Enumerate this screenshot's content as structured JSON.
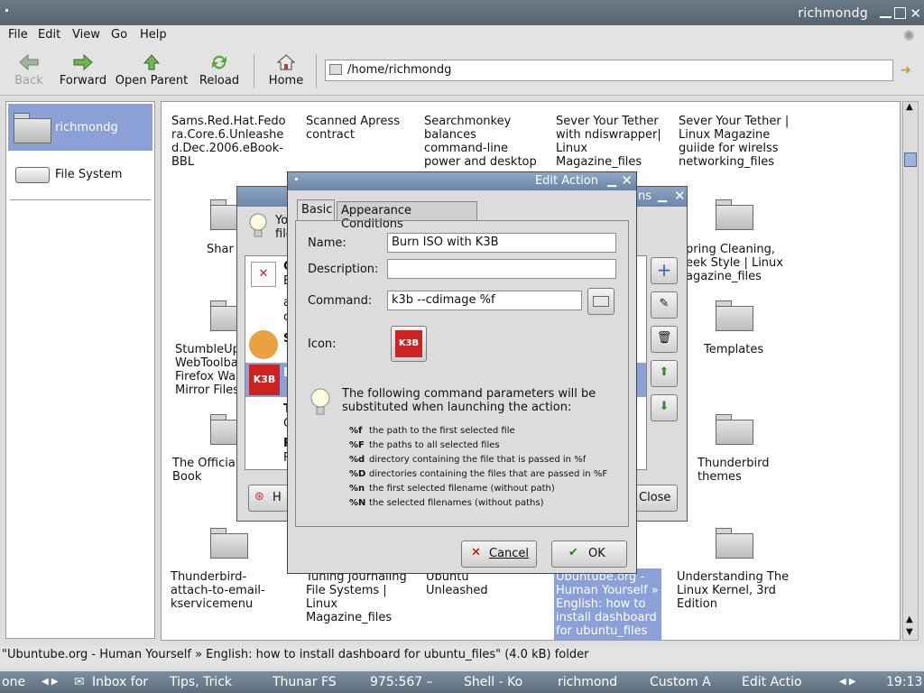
{
  "window": {
    "title": "richmondg"
  },
  "menu": [
    "File",
    "Edit",
    "View",
    "Go",
    "Help"
  ],
  "toolbar": {
    "back": "Back",
    "forward": "Forward",
    "open_parent": "Open Parent",
    "reload": "Reload",
    "home": "Home"
  },
  "location": {
    "path": "/home/richmondg"
  },
  "sidebar": [
    {
      "label": "richmondg",
      "icon": "home-folder-icon"
    },
    {
      "label": "File System",
      "icon": "drive-icon"
    }
  ],
  "files": {
    "row1": [
      "Sams.Red.Hat.Fedora.Core.6.Unleashed.Dec.2006.eBook-BBL",
      "Scanned Apress contract",
      "Searchmonkey balances command-line power and desktop",
      "Sever Your Tether with ndiswrapper| Linux Magazine_files",
      "Sever Your Tether | Linux Magazine guiide for wirelss networking_files"
    ],
    "row2_visible": [
      "Shar",
      "pring Cleaning, eek Style | Linux agazine_files"
    ],
    "row3_visible": [
      "StumbleUp WebToolba Firefox Wal Mirror Files",
      "Templates"
    ],
    "row4_visible": [
      "The Official Book",
      "Thunderbird themes"
    ],
    "row5": [
      "Thunderbird-attach-to-email-kservicemenu",
      "Tuning Journaling File Systems | Linux Magazine_files",
      "Ubuntu Unleashed",
      "Ubuntube.org - Human Yourself » English: how to install dashboard for ubuntu_files",
      "Understanding The Linux Kernel, 3rd Edition"
    ]
  },
  "statusbar": {
    "text": "\"Ubuntube.org - Human Yourself » English: how to install dashboard for ubuntu_files\" (4.0 kB) folder"
  },
  "taskbar": {
    "items": [
      "one",
      "Inbox for",
      "Tips, Trick",
      "Thunar FS",
      "975:567 –",
      "Shell - Ko",
      "richmond",
      "Custom A",
      "Edit Actio"
    ],
    "clock": "19:13"
  },
  "bg_dialog": {
    "title_fragment": "ns",
    "info_fragment": [
      "Yo",
      "file"
    ],
    "close_label": "Close",
    "help_label": "H",
    "list_fragments": [
      "C",
      "E",
      "a",
      "c",
      "S",
      "B",
      "T",
      "C",
      "P",
      "F"
    ]
  },
  "dialog": {
    "title": "Edit Action",
    "tabs": [
      "Basic",
      "Appearance Conditions"
    ],
    "name_label": "Name:",
    "name_value": "Burn ISO with K3B",
    "description_label": "Description:",
    "description_value": "",
    "command_label": "Command:",
    "command_value": "k3b --cdimage %f",
    "icon_label": "Icon:",
    "info_text": "The following command parameters will be substituted when launching the action:",
    "params": [
      {
        "key": "%f",
        "desc": "the path to the first selected file"
      },
      {
        "key": "%F",
        "desc": "the paths to all selected files"
      },
      {
        "key": "%d",
        "desc": "directory containing the file that is passed in %f"
      },
      {
        "key": "%D",
        "desc": "directories containing the files that are passed in %F"
      },
      {
        "key": "%n",
        "desc": "the first selected filename (without path)"
      },
      {
        "key": "%N",
        "desc": "the selected filenames (without paths)"
      }
    ],
    "cancel_label": "Cancel",
    "ok_label": "OK"
  },
  "colors": {
    "selection": "#8aa0d6",
    "titlebar": "#6a83a6"
  }
}
